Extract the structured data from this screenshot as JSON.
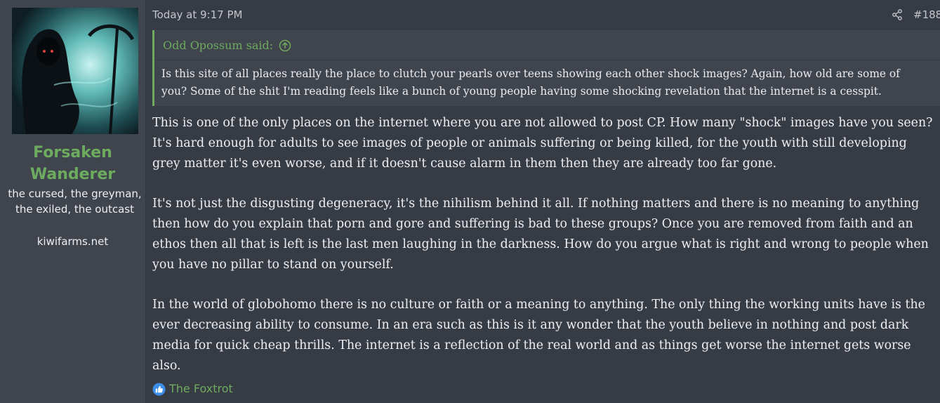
{
  "user": {
    "name": "Forsaken Wanderer",
    "title": "the cursed, the greyman, the exiled, the outcast",
    "site": "kiwifarms.net"
  },
  "post": {
    "time": "Today at 9:17 PM",
    "number": "#188",
    "quote": {
      "author": "Odd Opossum said:",
      "text": "Is this site of all places really the place to clutch your pearls over teens showing each other shock images? Again, how old are some of you? Some of the shit I'm reading feels like a bunch of young people having some shocking revelation that the internet is a cesspit."
    },
    "paragraphs": [
      "This is one of the only places on the internet where you are not allowed to post CP. How many \"shock\" images have you seen? It's hard enough for adults to see images of people or animals suffering or being killed, for the youth with still developing grey matter it's even worse, and if it doesn't cause alarm in them then they are already too far gone.",
      "It's not just the disgusting degeneracy, it's the nihilism behind it all. If nothing matters and there is no meaning to anything then how do you explain that porn and gore and suffering is bad to these groups? Once you are removed from faith and an ethos then all that is left is the last men laughing in the darkness. How do you argue what is right and wrong to people when you have no pillar to stand on yourself.",
      "In the world of globohomo there is no culture or faith or a meaning to anything. The only thing the working units have is the ever decreasing ability to consume. In an era such as this is it any wonder that the youth believe in nothing and post dark media for quick cheap thrills. The internet is a reflection of the real world and as things get worse the internet gets worse also."
    ],
    "reaction": {
      "icon": "like-icon",
      "name": "The Foxtrot"
    }
  },
  "colors": {
    "accent": "#6dab5f",
    "background": "#373b44",
    "panel": "#40444d"
  }
}
